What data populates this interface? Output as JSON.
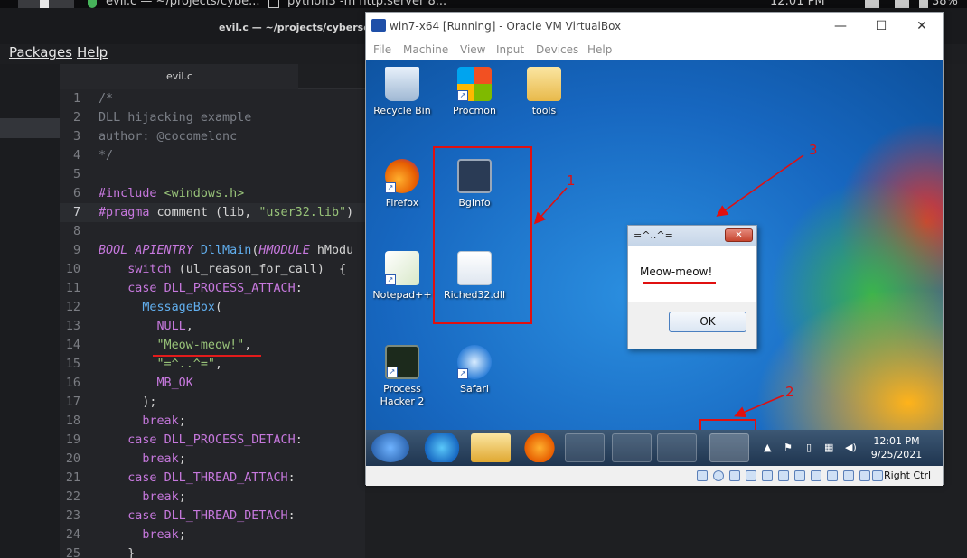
{
  "system_bar": {
    "items": [
      "evil.c — ~/projects/cybe...",
      "python3 -m http.server 8...",
      "12:01 PM",
      "38%"
    ]
  },
  "editor": {
    "window_title": "evil.c — ~/projects/cybersec_",
    "menu": [
      "Packages",
      "Help"
    ],
    "tab": "evil.c",
    "current_line": 7,
    "lines": [
      {
        "n": "1",
        "text": "/*"
      },
      {
        "n": "2",
        "text": "DLL hijacking example"
      },
      {
        "n": "3",
        "text": "author: @cocomelonc"
      },
      {
        "n": "4",
        "text": "*/"
      },
      {
        "n": "5",
        "text": ""
      },
      {
        "n": "6",
        "text": "#include <windows.h>"
      },
      {
        "n": "7",
        "text": "#pragma comment (lib, \"user32.lib\")"
      },
      {
        "n": "8",
        "text": ""
      },
      {
        "n": "9",
        "text": "BOOL APIENTRY DllMain(HMODULE hModu"
      },
      {
        "n": "10",
        "text": "    switch (ul_reason_for_call)  {"
      },
      {
        "n": "11",
        "text": "    case DLL_PROCESS_ATTACH:"
      },
      {
        "n": "12",
        "text": "      MessageBox("
      },
      {
        "n": "13",
        "text": "        NULL,"
      },
      {
        "n": "14",
        "text": "        \"Meow-meow!\","
      },
      {
        "n": "15",
        "text": "        \"=^..^=\","
      },
      {
        "n": "16",
        "text": "        MB_OK"
      },
      {
        "n": "17",
        "text": "      );"
      },
      {
        "n": "18",
        "text": "      break;"
      },
      {
        "n": "19",
        "text": "    case DLL_PROCESS_DETACH:"
      },
      {
        "n": "20",
        "text": "      break;"
      },
      {
        "n": "21",
        "text": "    case DLL_THREAD_ATTACH:"
      },
      {
        "n": "22",
        "text": "      break;"
      },
      {
        "n": "23",
        "text": "    case DLL_THREAD_DETACH:"
      },
      {
        "n": "24",
        "text": "      break;"
      },
      {
        "n": "25",
        "text": "    }"
      }
    ]
  },
  "vbox": {
    "title": "win7-x64 [Running] - Oracle VM VirtualBox",
    "menu": [
      "File",
      "Machine",
      "View",
      "Input",
      "Devices",
      "Help"
    ],
    "host_key": "Right Ctrl"
  },
  "guest": {
    "desktop_icons": [
      "Recycle Bin",
      "Procmon",
      "tools",
      "Firefox",
      "BgInfo",
      "Notepad++",
      "Riched32.dll",
      "Process Hacker 2",
      "Safari"
    ],
    "annotations": [
      "1",
      "2",
      "3"
    ],
    "messagebox": {
      "title": "=^..^=",
      "text": "Meow-meow!",
      "ok": "OK",
      "close": "✕"
    },
    "clock": {
      "time": "12:01 PM",
      "date": "9/25/2021"
    }
  },
  "colors": {
    "annotation_red": "#e01010",
    "editor_bg": "#232428",
    "keyword": "#c678dd",
    "string": "#98c379",
    "function": "#61afef",
    "comment": "#7b7f87"
  }
}
